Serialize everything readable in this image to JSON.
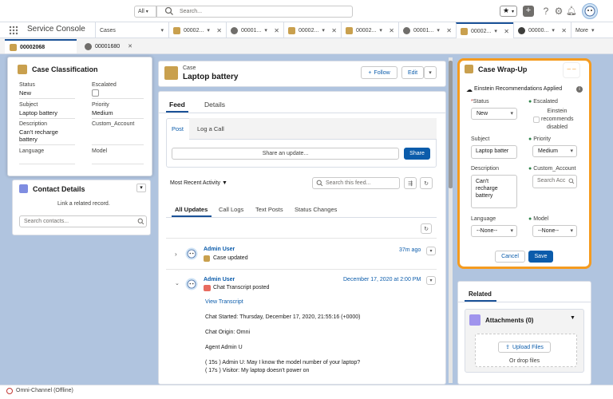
{
  "header": {
    "scope": "All",
    "search_placeholder": "Search..."
  },
  "app": {
    "name": "Service Console",
    "tabs": [
      {
        "label": "Cases",
        "icon": "none"
      },
      {
        "label": "00002...",
        "icon": "case"
      },
      {
        "label": "00001...",
        "icon": "chat"
      },
      {
        "label": "00002...",
        "icon": "case"
      },
      {
        "label": "00002...",
        "icon": "case"
      },
      {
        "label": "00001...",
        "icon": "chat"
      },
      {
        "label": "00002...",
        "icon": "case"
      },
      {
        "label": "00000...",
        "icon": "info"
      }
    ],
    "more_label": "More"
  },
  "subtabs": [
    {
      "label": "00002068"
    },
    {
      "label": "00001680"
    }
  ],
  "case_classification": {
    "title": "Case Classification",
    "status_label": "Status",
    "status_value": "New",
    "escalated_label": "Escalated",
    "subject_label": "Subject",
    "subject_value": "Laptop battery",
    "priority_label": "Priority",
    "priority_value": "Medium",
    "description_label": "Description",
    "description_value_1": "Can't recharge",
    "description_value_2": "battery",
    "custom_account_label": "Custom_Account",
    "language_label": "Language",
    "model_label": "Model"
  },
  "contact_details": {
    "title": "Contact Details",
    "link_text": "Link a related record.",
    "search_placeholder": "Search contacts..."
  },
  "case_header": {
    "object_label": "Case",
    "record_name": "Laptop battery",
    "follow_label": "Follow",
    "edit_label": "Edit"
  },
  "feed": {
    "tabs": [
      "Feed",
      "Details"
    ],
    "post_tab": "Post",
    "log_call_tab": "Log a Call",
    "share_placeholder": "Share an update...",
    "share_button": "Share",
    "sort_label": "Most Recent Activity",
    "search_placeholder": "Search this feed...",
    "filters": [
      "All Updates",
      "Call Logs",
      "Text Posts",
      "Status Changes"
    ],
    "items": [
      {
        "author": "Admin User",
        "action": "Case updated",
        "time": "37m ago"
      },
      {
        "author": "Admin User",
        "action": "Chat Transcript posted",
        "time": "December 17, 2020 at 2:00 PM"
      }
    ],
    "view_transcript": "View Transcript",
    "transcript_lines": [
      "Chat Started: Thursday, December 17, 2020, 21:55:16 (+0000)",
      "Chat Origin: Omni",
      "Agent Admin U",
      "( 15s ) Admin U: May I know the model number of your laptop?",
      "( 17s ) Visitor: My laptop doesn't power on"
    ]
  },
  "wrapup": {
    "title": "Case Wrap-Up",
    "einstein_label": "Einstein Recommendations Applied",
    "status_label": "Status",
    "status_value": "New",
    "escalated_label": "Escalated",
    "einstein_note_1": "Einstein",
    "einstein_note_2": "recommends",
    "einstein_note_3": "disabled",
    "subject_label": "Subject",
    "subject_value": "Laptop batter",
    "priority_label": "Priority",
    "priority_value": "Medium",
    "description_label": "Description",
    "description_value_1": "Can't",
    "description_value_2": "recharge",
    "description_value_3": "battery",
    "custom_account_label": "Custom_Account",
    "custom_account_placeholder": "Search Acc",
    "language_label": "Language",
    "language_value": "--None--",
    "model_label": "Model",
    "model_value": "--None--",
    "cancel_label": "Cancel",
    "save_label": "Save",
    "highlight_color": "#f59b1f"
  },
  "related": {
    "tab": "Related",
    "attachments_title": "Attachments (0)",
    "upload_label": "Upload Files",
    "drop_label": "Or drop files"
  },
  "statusbar": {
    "omni_label": "Omni-Channel (Offline)"
  }
}
